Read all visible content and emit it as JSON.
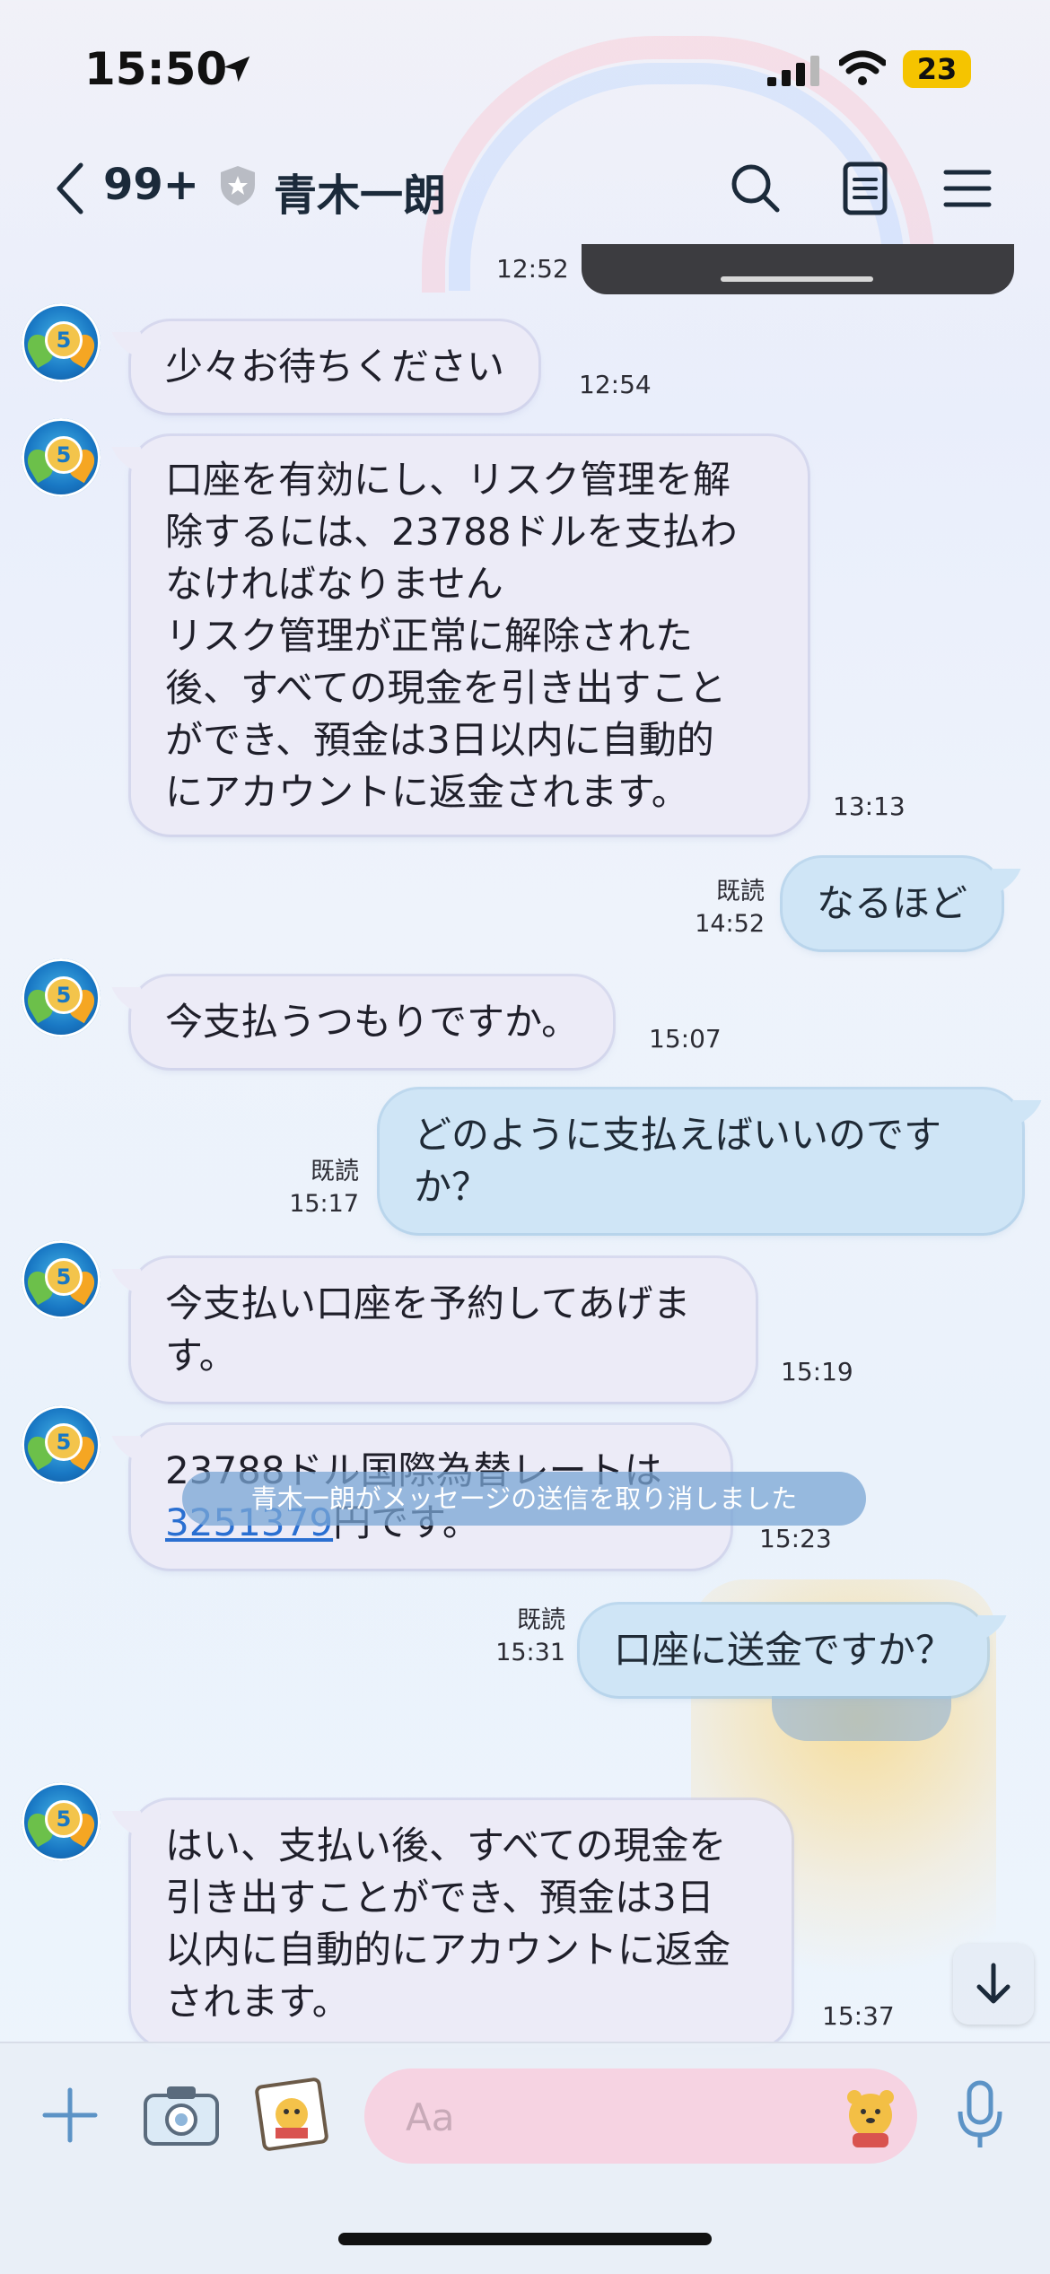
{
  "status_bar": {
    "time": "15:50",
    "battery": "23"
  },
  "header": {
    "back_count": "99+",
    "chat_name": "青木一朗"
  },
  "messages": [
    {
      "type": "in",
      "text": "少々お待ちください",
      "time": "12:54"
    },
    {
      "type": "in",
      "text": "口座を有効にし、リスク管理を解\n除するには、23788ドルを支払わ\nなければなりません\nリスク管理が正常に解除された\n後、すべての現金を引き出すこと\nができ、預金は3日以内に自動的\nにアカウントに返金されます。",
      "time": "13:13"
    },
    {
      "type": "out",
      "text": "なるほど",
      "read": "既読",
      "time": "14:52"
    },
    {
      "type": "in",
      "text": "今支払うつもりですか。",
      "time": "15:07"
    },
    {
      "type": "out",
      "text": "どのように支払えばいいのです\nか？",
      "read": "既読",
      "time": "15:17"
    },
    {
      "type": "in",
      "text": "今支払い口座を予約してあげま\nす。",
      "time": "15:19"
    },
    {
      "type": "in",
      "text_before": "23788ドル国際為替レートは",
      "link": "3251379",
      "text_after": "円です。",
      "time": "15:23"
    },
    {
      "type": "out",
      "text": "口座に送金ですか？",
      "read": "既読",
      "time": "15:31"
    },
    {
      "type": "system",
      "text": "青木一朗がメッセージの送信を取り消しました"
    },
    {
      "type": "in",
      "text": "はい、支払い後、すべての現金を\n引き出すことができ、預金は3日\n以内に自動的にアカウントに返金\nされます。",
      "time": "15:37"
    }
  ],
  "partial_time_top": "12:52",
  "input": {
    "placeholder": "Aa"
  },
  "avatar": {
    "badge": "5"
  },
  "colors": {
    "incoming_bubble": "#ecebf7",
    "outgoing_bubble": "#cfe5f6",
    "input_pill": "#f6d3e2",
    "link": "#2a6fd1",
    "system_notice": "#7aa6d4"
  },
  "icons": [
    "location-arrow-icon",
    "signal-icon",
    "wifi-icon",
    "back-chevron-icon",
    "shield-badge-icon",
    "search-icon",
    "notes-icon",
    "menu-icon",
    "plus-icon",
    "camera-icon",
    "photo-icon",
    "sticker-icon",
    "mic-icon",
    "arrow-down-icon"
  ]
}
